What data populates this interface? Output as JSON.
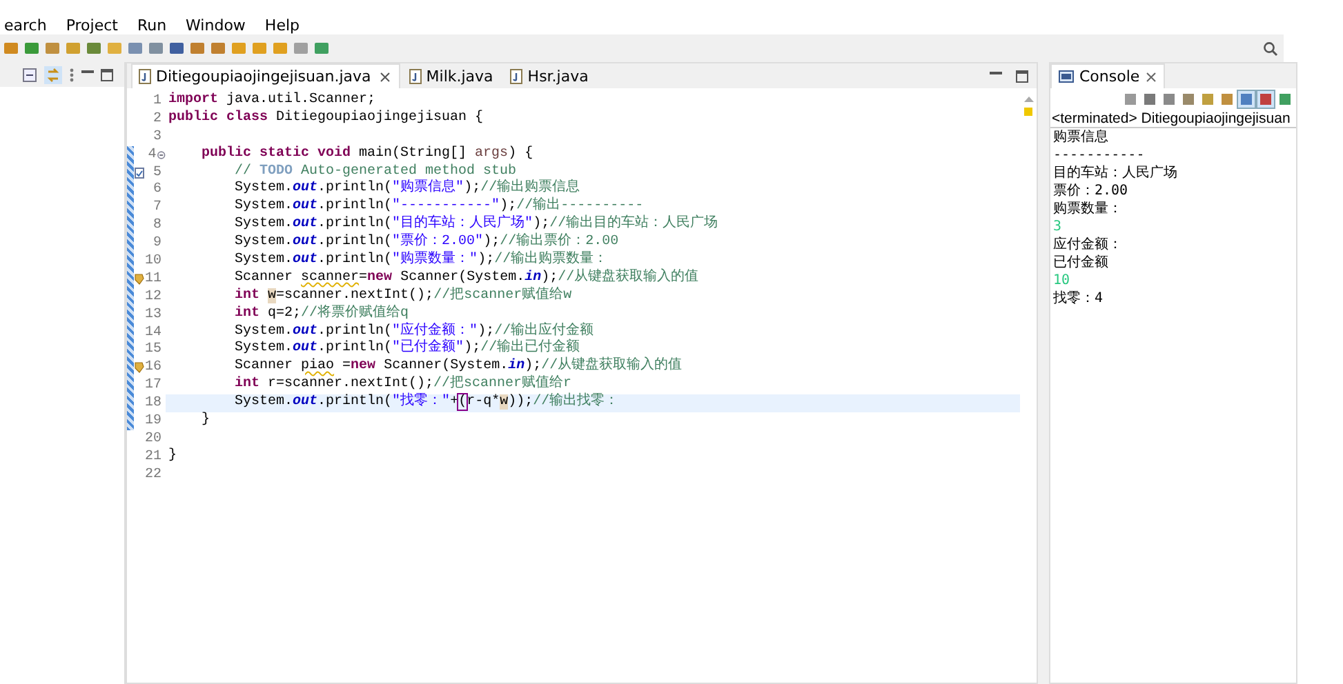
{
  "menu": [
    {
      "label": "earch"
    },
    {
      "label": "Project"
    },
    {
      "label": "Run"
    },
    {
      "label": "Window"
    },
    {
      "label": "Help"
    }
  ],
  "editor_tabs": [
    {
      "label": "Ditiegoupiaojingejisuan.java",
      "selected": true,
      "closable": true
    },
    {
      "label": "Milk.java",
      "selected": false,
      "closable": false
    },
    {
      "label": "Hsr.java",
      "selected": false,
      "closable": false
    }
  ],
  "code": [
    {
      "n": "1",
      "current": false,
      "t": [
        {
          "kind": "kw",
          "s": "import"
        },
        {
          "kind": "tx",
          "s": " java.util.Scanner;"
        }
      ]
    },
    {
      "n": "2",
      "current": false,
      "t": [
        {
          "kind": "kw",
          "s": "public class"
        },
        {
          "kind": "tx",
          "s": " Ditiegoupiaojingejisuan {"
        }
      ]
    },
    {
      "n": "3",
      "current": false
    },
    {
      "n": "4",
      "current": false,
      "fold": true,
      "t": [
        {
          "kind": "kw",
          "s": "    public static void"
        },
        {
          "kind": "tx",
          "s": " main(String[] "
        },
        {
          "kind": "param",
          "s": "args"
        },
        {
          "kind": "tx",
          "s": ") {"
        }
      ]
    },
    {
      "n": "5",
      "current": false,
      "task": true,
      "t": [
        {
          "kind": "cm",
          "s": "        // "
        },
        {
          "kind": "todo",
          "s": "TODO"
        },
        {
          "kind": "cm",
          "s": " Auto-generated method stub"
        }
      ]
    },
    {
      "n": "6",
      "current": false,
      "t": [
        {
          "kind": "tx",
          "s": "        System."
        },
        {
          "kind": "fld",
          "s": "out"
        },
        {
          "kind": "tx",
          "s": ".println("
        },
        {
          "kind": "str",
          "s": "\"购票信息\""
        },
        {
          "kind": "tx",
          "s": ");"
        },
        {
          "kind": "cm",
          "s": "//输出购票信息"
        }
      ]
    },
    {
      "n": "7",
      "current": false,
      "t": [
        {
          "kind": "tx",
          "s": "        System."
        },
        {
          "kind": "fld",
          "s": "out"
        },
        {
          "kind": "tx",
          "s": ".println("
        },
        {
          "kind": "str",
          "s": "\"-----------\""
        },
        {
          "kind": "tx",
          "s": ");"
        },
        {
          "kind": "cm",
          "s": "//输出----------"
        }
      ]
    },
    {
      "n": "8",
      "current": false,
      "t": [
        {
          "kind": "tx",
          "s": "        System."
        },
        {
          "kind": "fld",
          "s": "out"
        },
        {
          "kind": "tx",
          "s": ".println("
        },
        {
          "kind": "str",
          "s": "\"目的车站：人民广场\""
        },
        {
          "kind": "tx",
          "s": ");"
        },
        {
          "kind": "cm",
          "s": "//输出目的车站：人民广场"
        }
      ]
    },
    {
      "n": "9",
      "current": false,
      "t": [
        {
          "kind": "tx",
          "s": "        System."
        },
        {
          "kind": "fld",
          "s": "out"
        },
        {
          "kind": "tx",
          "s": ".println("
        },
        {
          "kind": "str",
          "s": "\"票价：2.00\""
        },
        {
          "kind": "tx",
          "s": ");"
        },
        {
          "kind": "cm",
          "s": "//输出票价：2.00"
        }
      ]
    },
    {
      "n": "10",
      "current": false,
      "t": [
        {
          "kind": "tx",
          "s": "        System."
        },
        {
          "kind": "fld",
          "s": "out"
        },
        {
          "kind": "tx",
          "s": ".println("
        },
        {
          "kind": "str",
          "s": "\"购票数量：\""
        },
        {
          "kind": "tx",
          "s": ");"
        },
        {
          "kind": "cm",
          "s": "//输出购票数量："
        }
      ]
    },
    {
      "n": "11",
      "current": false,
      "warning": true,
      "t": [
        {
          "kind": "tx",
          "s": "        Scanner "
        },
        {
          "kind": "warn",
          "s": "scanner"
        },
        {
          "kind": "tx",
          "s": "="
        },
        {
          "kind": "kw",
          "s": "new"
        },
        {
          "kind": "tx",
          "s": " Scanner(System."
        },
        {
          "kind": "fld",
          "s": "in"
        },
        {
          "kind": "tx",
          "s": ");"
        },
        {
          "kind": "cm",
          "s": "//从键盘获取输入的值"
        }
      ]
    },
    {
      "n": "12",
      "current": false,
      "t": [
        {
          "kind": "kw",
          "s": "        int "
        },
        {
          "kind": "mark",
          "s": "w"
        },
        {
          "kind": "tx",
          "s": "=scanner.nextInt();"
        },
        {
          "kind": "cm",
          "s": "//把scanner赋值给w"
        }
      ]
    },
    {
      "n": "13",
      "current": false,
      "t": [
        {
          "kind": "kw",
          "s": "        int"
        },
        {
          "kind": "tx",
          "s": " q=2;"
        },
        {
          "kind": "cm",
          "s": "//将票价赋值给q"
        }
      ]
    },
    {
      "n": "14",
      "current": false,
      "t": [
        {
          "kind": "tx",
          "s": "        System."
        },
        {
          "kind": "fld",
          "s": "out"
        },
        {
          "kind": "tx",
          "s": ".println("
        },
        {
          "kind": "str",
          "s": "\"应付金额：\""
        },
        {
          "kind": "tx",
          "s": ");"
        },
        {
          "kind": "cm",
          "s": "//输出应付金额"
        }
      ]
    },
    {
      "n": "15",
      "current": false,
      "t": [
        {
          "kind": "tx",
          "s": "        System."
        },
        {
          "kind": "fld",
          "s": "out"
        },
        {
          "kind": "tx",
          "s": ".println("
        },
        {
          "kind": "str",
          "s": "\"已付金额\""
        },
        {
          "kind": "tx",
          "s": ");"
        },
        {
          "kind": "cm",
          "s": "//输出已付金额"
        }
      ]
    },
    {
      "n": "16",
      "current": false,
      "warning": true,
      "t": [
        {
          "kind": "tx",
          "s": "        Scanner "
        },
        {
          "kind": "warn",
          "s": "piao"
        },
        {
          "kind": "tx",
          "s": " ="
        },
        {
          "kind": "kw",
          "s": "new"
        },
        {
          "kind": "tx",
          "s": " Scanner(System."
        },
        {
          "kind": "fld",
          "s": "in"
        },
        {
          "kind": "tx",
          "s": ");"
        },
        {
          "kind": "cm",
          "s": "//从键盘获取输入的值"
        }
      ]
    },
    {
      "n": "17",
      "current": false,
      "t": [
        {
          "kind": "kw",
          "s": "        int"
        },
        {
          "kind": "tx",
          "s": " r=scanner.nextInt();"
        },
        {
          "kind": "cm",
          "s": "//把scanner赋值给r"
        }
      ]
    },
    {
      "n": "18",
      "current": true,
      "t": [
        {
          "kind": "tx",
          "s": "        System."
        },
        {
          "kind": "fld",
          "s": "out"
        },
        {
          "kind": "tx",
          "s": ".println("
        },
        {
          "kind": "str",
          "s": "\"找零：\""
        },
        {
          "kind": "tx",
          "s": "+"
        },
        {
          "kind": "bracket",
          "s": "("
        },
        {
          "kind": "tx",
          "s": "r-q*"
        },
        {
          "kind": "mark",
          "s": "w"
        },
        {
          "kind": "tx",
          "s": "));"
        },
        {
          "kind": "cm",
          "s": "//输出找零："
        }
      ]
    },
    {
      "n": "19",
      "current": false,
      "t": [
        {
          "kind": "tx",
          "s": "    }"
        }
      ]
    },
    {
      "n": "20",
      "current": false
    },
    {
      "n": "21",
      "current": false,
      "t": [
        {
          "kind": "tx",
          "s": "}"
        }
      ]
    },
    {
      "n": "22",
      "current": false
    }
  ],
  "console": {
    "title": "Console",
    "status": "<terminated> Ditiegoupiaojingejisuan",
    "lines": [
      {
        "kind": "out",
        "s": "购票信息"
      },
      {
        "kind": "out",
        "s": "-----------"
      },
      {
        "kind": "out",
        "s": "目的车站：人民广场"
      },
      {
        "kind": "out",
        "s": "票价：2.00"
      },
      {
        "kind": "out",
        "s": "购票数量："
      },
      {
        "kind": "in",
        "s": "3"
      },
      {
        "kind": "out",
        "s": "应付金额："
      },
      {
        "kind": "out",
        "s": "已付金额"
      },
      {
        "kind": "in",
        "s": "10"
      },
      {
        "kind": "out",
        "s": "找零：4"
      }
    ]
  }
}
